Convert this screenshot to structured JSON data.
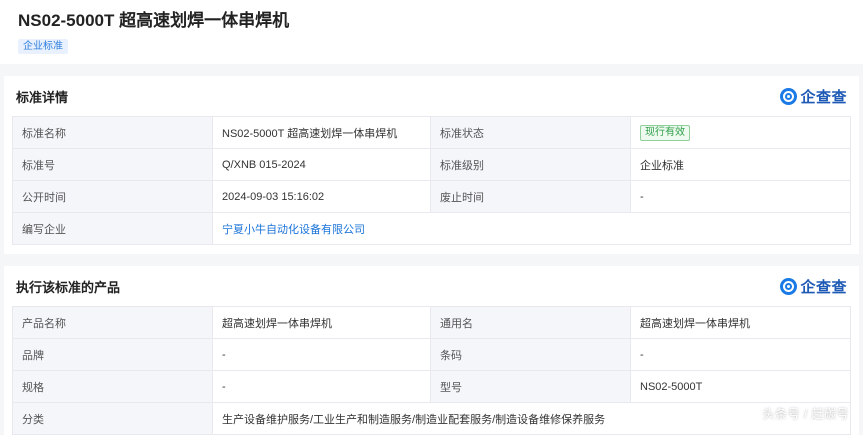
{
  "header": {
    "title": "NS02-5000T 超高速划焊一体串焊机",
    "tag": "企业标准"
  },
  "brand": {
    "logo_text": "企查查",
    "accent": "#1a7ae6"
  },
  "details": {
    "section_title": "标准详情",
    "rows": [
      {
        "l1": "标准名称",
        "v1": "NS02-5000T 超高速划焊一体串焊机",
        "l2": "标准状态",
        "v2": "现行有效"
      },
      {
        "l1": "标准号",
        "v1": "Q/XNB 015-2024",
        "l2": "标准级别",
        "v2": "企业标准"
      },
      {
        "l1": "公开时间",
        "v1": "2024-09-03 15:16:02",
        "l2": "废止时间",
        "v2": "-"
      },
      {
        "l1": "编写企业",
        "v1": "宁夏小牛自动化设备有限公司"
      }
    ]
  },
  "products": {
    "section_title": "执行该标准的产品",
    "rows": [
      {
        "l1": "产品名称",
        "v1": "超高速划焊一体串焊机",
        "l2": "通用名",
        "v2": "超高速划焊一体串焊机"
      },
      {
        "l1": "品牌",
        "v1": "-",
        "l2": "条码",
        "v2": "-"
      },
      {
        "l1": "规格",
        "v1": "-",
        "l2": "型号",
        "v2": "NS02-5000T"
      },
      {
        "l1": "分类",
        "v1": "生产设备维护服务/工业生产和制造服务/制造业配套服务/制造设备维修保养服务"
      }
    ]
  },
  "watermark": "头条号 / 赶碳号"
}
